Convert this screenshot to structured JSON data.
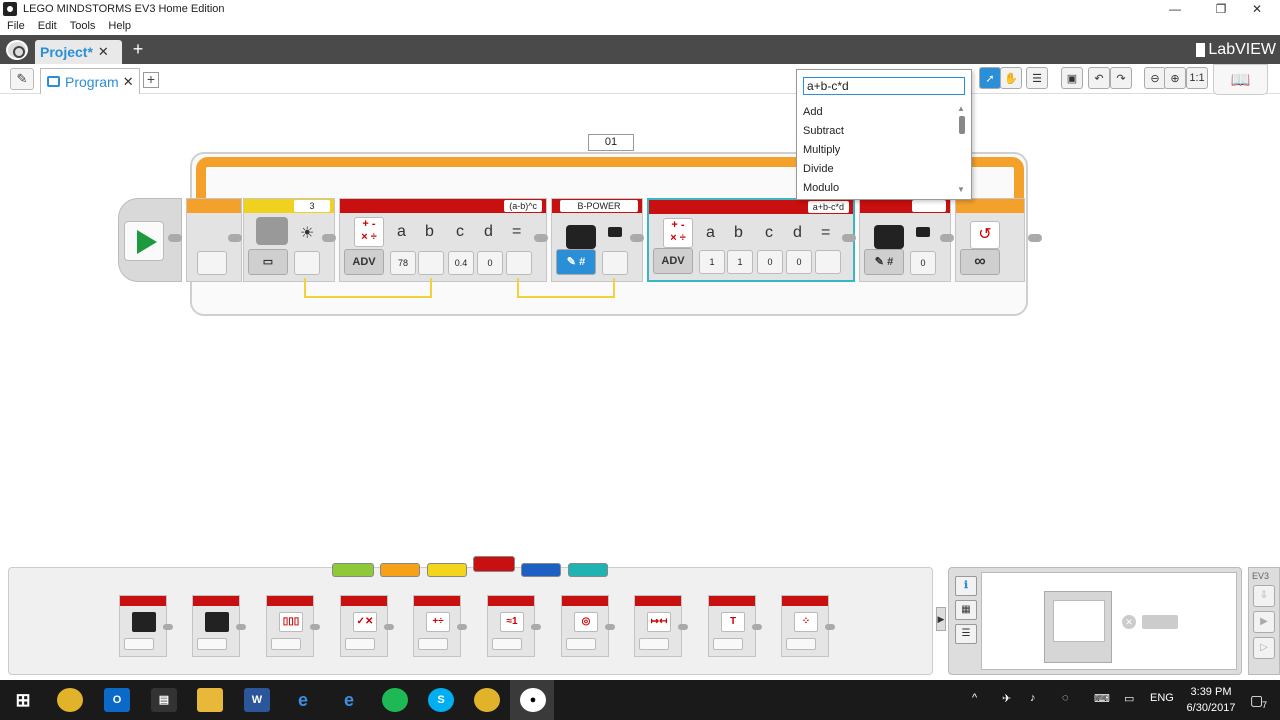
{
  "window": {
    "title": "LEGO MINDSTORMS EV3 Home Edition",
    "controls": [
      "—",
      "❐",
      "✕"
    ]
  },
  "menu": [
    "File",
    "Edit",
    "Tools",
    "Help"
  ],
  "project_tab": {
    "label": "Project*",
    "close": "✕",
    "add": "+"
  },
  "brand": "LabVIEW",
  "program_tab": {
    "label": "Program",
    "close": "✕",
    "add": "+"
  },
  "loop": {
    "label": "01"
  },
  "blocks": {
    "wait_value": "3",
    "math1": {
      "expression": "(a-b)^c",
      "mode": "ADV",
      "vars": [
        "a",
        "b",
        "c",
        "d",
        "="
      ],
      "values": [
        "78",
        "0.4",
        "0"
      ]
    },
    "var1": {
      "name": "B-POWER",
      "hash": "#"
    },
    "math2": {
      "expression": "a+b-c*d",
      "mode": "ADV",
      "vars": [
        "a",
        "b",
        "c",
        "d",
        "="
      ],
      "values": [
        "1",
        "1",
        "0",
        "0"
      ]
    },
    "var2": {
      "hash": "#",
      "value": "0"
    },
    "loop_end": {
      "symbol": "∞"
    }
  },
  "dropdown": {
    "search_value": "a+b-c*d",
    "items": [
      "Add",
      "Subtract",
      "Multiply",
      "Divide",
      "Modulo"
    ]
  },
  "hw_panel": {
    "title": "EV3"
  },
  "taskbar": {
    "language": "ENG",
    "time": "3:39 PM",
    "date": "6/30/2017",
    "notification_count": "7"
  },
  "colors": {
    "accent": "#2a8fd6",
    "loop": "#f3a12a",
    "data_header": "#c91010",
    "wait_header": "#f0d21e"
  }
}
